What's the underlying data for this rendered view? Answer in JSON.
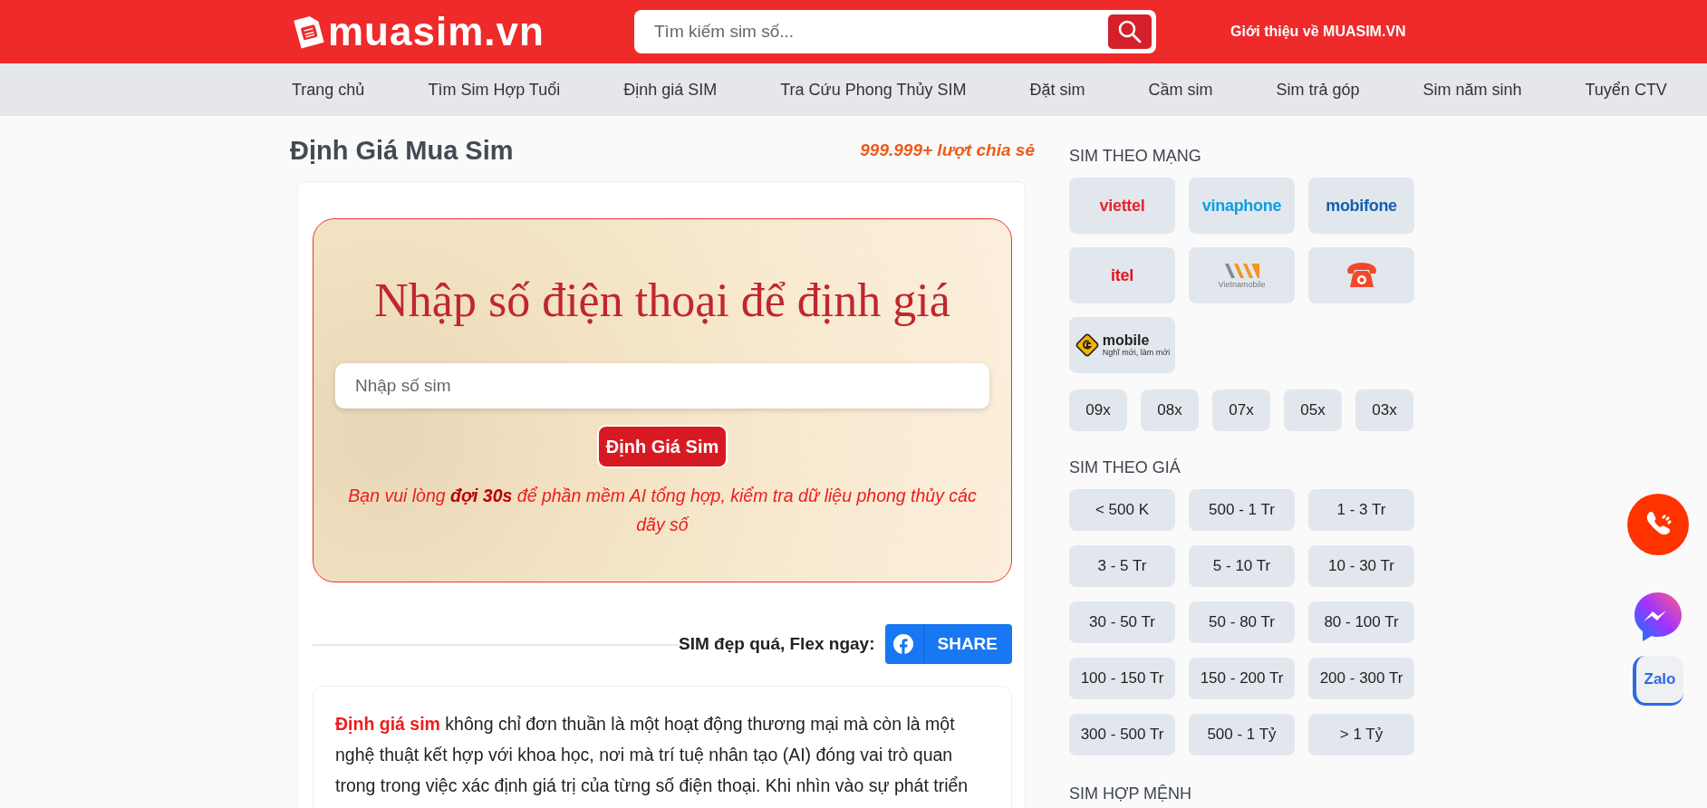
{
  "header": {
    "logo": "muasim.vn",
    "search": {
      "placeholder": "Tìm kiếm sim số..."
    },
    "about_link": "Giới thiệu về MUASIM.VN"
  },
  "nav": [
    "Trang chủ",
    "Tìm Sim Hợp Tuổi",
    "Định giá SIM",
    "Tra Cứu Phong Thủy SIM",
    "Đặt sim",
    "Cầm sim",
    "Sim trả góp",
    "Sim năm sinh",
    "Tuyển CTV"
  ],
  "page": {
    "title": "Định Giá Mua Sim",
    "share_count": "999.999+ lượt chia sẻ"
  },
  "valuation": {
    "heading": "Nhập số điện thoại để định giá",
    "input": {
      "placeholder": "Nhập số sim"
    },
    "button": "Định Giá Sim",
    "note": "Bạn vui lòng **đợi 30s** để phần mềm AI tổng hợp, kiểm tra dữ liệu phong thủy các dãy số"
  },
  "share": {
    "label": "SIM đẹp quá, Flex ngay:",
    "button": "SHARE"
  },
  "article": {
    "paragraph": "**Định giá sim** không chỉ đơn thuần là một hoạt động thương mại mà còn là một nghệ thuật kết hợp với khoa học, nơi mà trí tuệ nhân tạo (AI) đóng vai trò quan trong trong việc xác định giá trị của từng số điện thoại. Khi nhìn vào sự phát triển"
  },
  "sidebar": {
    "network_title": "SIM THEO MẠNG",
    "carriers": [
      {
        "kind": "wordmark",
        "text": "viettel",
        "color": "#e3262e"
      },
      {
        "kind": "wordmark",
        "text": "vinaphone",
        "color": "#0e9ee3"
      },
      {
        "kind": "wordmark",
        "text": "mobifone",
        "color": "#1560ac"
      },
      {
        "kind": "wordmark",
        "text": "itel",
        "color": "#e3141d"
      },
      {
        "kind": "vietnamobile",
        "text": "Vietnamobile",
        "color": "#f7941d"
      },
      {
        "kind": "phone",
        "color": "#f04a2a"
      },
      {
        "kind": "gmobile",
        "text": "mobile",
        "tagline": "Nghĩ mới, làm mới",
        "color": "#f5b400"
      }
    ],
    "prefixes": [
      "09x",
      "08x",
      "07x",
      "05x",
      "03x"
    ],
    "price_title": "SIM THEO GIÁ",
    "prices": [
      "< 500 K",
      "500 - 1 Tr",
      "1 - 3 Tr",
      "3 - 5 Tr",
      "5 - 10 Tr",
      "10 - 30 Tr",
      "30 - 50 Tr",
      "50 - 80 Tr",
      "80 - 100 Tr",
      "100 - 150 Tr",
      "150 - 200 Tr",
      "200 - 300 Tr",
      "300 - 500 Tr",
      "500 - 1 Tỷ",
      "> 1 Tỷ"
    ],
    "destiny_title": "SIM HỢP MỆNH"
  },
  "floating": {
    "zalo": "Zalo"
  }
}
